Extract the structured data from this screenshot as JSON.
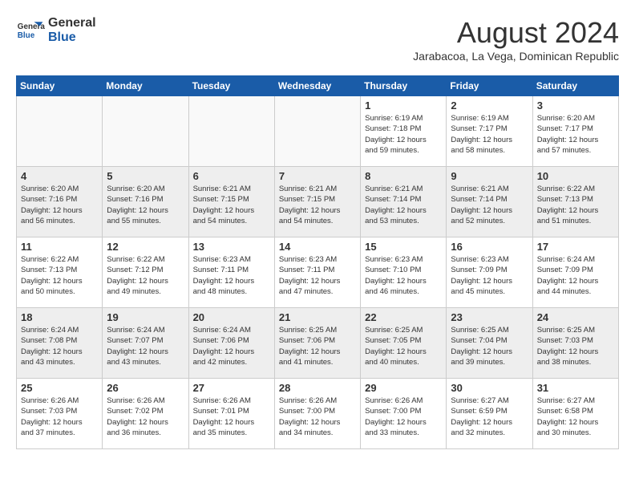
{
  "header": {
    "logo_line1": "General",
    "logo_line2": "Blue",
    "month_year": "August 2024",
    "location": "Jarabacoa, La Vega, Dominican Republic"
  },
  "days_of_week": [
    "Sunday",
    "Monday",
    "Tuesday",
    "Wednesday",
    "Thursday",
    "Friday",
    "Saturday"
  ],
  "weeks": [
    [
      {
        "day": "",
        "info": ""
      },
      {
        "day": "",
        "info": ""
      },
      {
        "day": "",
        "info": ""
      },
      {
        "day": "",
        "info": ""
      },
      {
        "day": "1",
        "info": "Sunrise: 6:19 AM\nSunset: 7:18 PM\nDaylight: 12 hours\nand 59 minutes."
      },
      {
        "day": "2",
        "info": "Sunrise: 6:19 AM\nSunset: 7:17 PM\nDaylight: 12 hours\nand 58 minutes."
      },
      {
        "day": "3",
        "info": "Sunrise: 6:20 AM\nSunset: 7:17 PM\nDaylight: 12 hours\nand 57 minutes."
      }
    ],
    [
      {
        "day": "4",
        "info": "Sunrise: 6:20 AM\nSunset: 7:16 PM\nDaylight: 12 hours\nand 56 minutes."
      },
      {
        "day": "5",
        "info": "Sunrise: 6:20 AM\nSunset: 7:16 PM\nDaylight: 12 hours\nand 55 minutes."
      },
      {
        "day": "6",
        "info": "Sunrise: 6:21 AM\nSunset: 7:15 PM\nDaylight: 12 hours\nand 54 minutes."
      },
      {
        "day": "7",
        "info": "Sunrise: 6:21 AM\nSunset: 7:15 PM\nDaylight: 12 hours\nand 54 minutes."
      },
      {
        "day": "8",
        "info": "Sunrise: 6:21 AM\nSunset: 7:14 PM\nDaylight: 12 hours\nand 53 minutes."
      },
      {
        "day": "9",
        "info": "Sunrise: 6:21 AM\nSunset: 7:14 PM\nDaylight: 12 hours\nand 52 minutes."
      },
      {
        "day": "10",
        "info": "Sunrise: 6:22 AM\nSunset: 7:13 PM\nDaylight: 12 hours\nand 51 minutes."
      }
    ],
    [
      {
        "day": "11",
        "info": "Sunrise: 6:22 AM\nSunset: 7:13 PM\nDaylight: 12 hours\nand 50 minutes."
      },
      {
        "day": "12",
        "info": "Sunrise: 6:22 AM\nSunset: 7:12 PM\nDaylight: 12 hours\nand 49 minutes."
      },
      {
        "day": "13",
        "info": "Sunrise: 6:23 AM\nSunset: 7:11 PM\nDaylight: 12 hours\nand 48 minutes."
      },
      {
        "day": "14",
        "info": "Sunrise: 6:23 AM\nSunset: 7:11 PM\nDaylight: 12 hours\nand 47 minutes."
      },
      {
        "day": "15",
        "info": "Sunrise: 6:23 AM\nSunset: 7:10 PM\nDaylight: 12 hours\nand 46 minutes."
      },
      {
        "day": "16",
        "info": "Sunrise: 6:23 AM\nSunset: 7:09 PM\nDaylight: 12 hours\nand 45 minutes."
      },
      {
        "day": "17",
        "info": "Sunrise: 6:24 AM\nSunset: 7:09 PM\nDaylight: 12 hours\nand 44 minutes."
      }
    ],
    [
      {
        "day": "18",
        "info": "Sunrise: 6:24 AM\nSunset: 7:08 PM\nDaylight: 12 hours\nand 43 minutes."
      },
      {
        "day": "19",
        "info": "Sunrise: 6:24 AM\nSunset: 7:07 PM\nDaylight: 12 hours\nand 43 minutes."
      },
      {
        "day": "20",
        "info": "Sunrise: 6:24 AM\nSunset: 7:06 PM\nDaylight: 12 hours\nand 42 minutes."
      },
      {
        "day": "21",
        "info": "Sunrise: 6:25 AM\nSunset: 7:06 PM\nDaylight: 12 hours\nand 41 minutes."
      },
      {
        "day": "22",
        "info": "Sunrise: 6:25 AM\nSunset: 7:05 PM\nDaylight: 12 hours\nand 40 minutes."
      },
      {
        "day": "23",
        "info": "Sunrise: 6:25 AM\nSunset: 7:04 PM\nDaylight: 12 hours\nand 39 minutes."
      },
      {
        "day": "24",
        "info": "Sunrise: 6:25 AM\nSunset: 7:03 PM\nDaylight: 12 hours\nand 38 minutes."
      }
    ],
    [
      {
        "day": "25",
        "info": "Sunrise: 6:26 AM\nSunset: 7:03 PM\nDaylight: 12 hours\nand 37 minutes."
      },
      {
        "day": "26",
        "info": "Sunrise: 6:26 AM\nSunset: 7:02 PM\nDaylight: 12 hours\nand 36 minutes."
      },
      {
        "day": "27",
        "info": "Sunrise: 6:26 AM\nSunset: 7:01 PM\nDaylight: 12 hours\nand 35 minutes."
      },
      {
        "day": "28",
        "info": "Sunrise: 6:26 AM\nSunset: 7:00 PM\nDaylight: 12 hours\nand 34 minutes."
      },
      {
        "day": "29",
        "info": "Sunrise: 6:26 AM\nSunset: 7:00 PM\nDaylight: 12 hours\nand 33 minutes."
      },
      {
        "day": "30",
        "info": "Sunrise: 6:27 AM\nSunset: 6:59 PM\nDaylight: 12 hours\nand 32 minutes."
      },
      {
        "day": "31",
        "info": "Sunrise: 6:27 AM\nSunset: 6:58 PM\nDaylight: 12 hours\nand 30 minutes."
      }
    ]
  ]
}
